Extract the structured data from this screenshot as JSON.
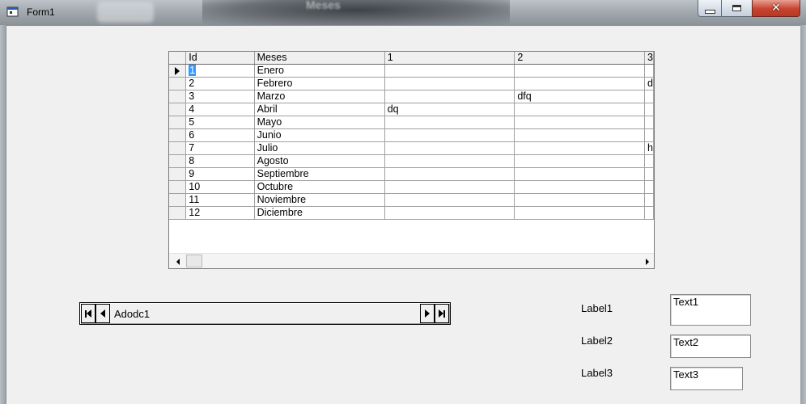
{
  "window": {
    "title": "Form1",
    "background_title": "Meses"
  },
  "grid": {
    "headers": [
      "Id",
      "Meses",
      "1",
      "2",
      "3"
    ],
    "rows": [
      [
        "1",
        "Enero",
        "",
        "",
        ""
      ],
      [
        "2",
        "Febrero",
        "",
        "",
        "d"
      ],
      [
        "3",
        "Marzo",
        "",
        "dfq",
        ""
      ],
      [
        "4",
        "Abril",
        "dq",
        "",
        ""
      ],
      [
        "5",
        "Mayo",
        "",
        "",
        ""
      ],
      [
        "6",
        "Junio",
        "",
        "",
        ""
      ],
      [
        "7",
        "Julio",
        "",
        "",
        "h"
      ],
      [
        "8",
        "Agosto",
        "",
        "",
        ""
      ],
      [
        "9",
        "Septiembre",
        "",
        "",
        ""
      ],
      [
        "10",
        "Octubre",
        "",
        "",
        ""
      ],
      [
        "11",
        "Noviembre",
        "",
        "",
        ""
      ],
      [
        "12",
        "Diciembre",
        "",
        "",
        ""
      ]
    ],
    "current_row": 1
  },
  "adodc": {
    "caption": "Adodc1"
  },
  "labels": {
    "label1": "Label1",
    "label2": "Label2",
    "label3": "Label3"
  },
  "textboxes": {
    "text1": "Text1",
    "text2": "Text2",
    "text3": "Text3"
  },
  "colors": {
    "selection": "#3399ff",
    "close_button": "#c7432e"
  }
}
